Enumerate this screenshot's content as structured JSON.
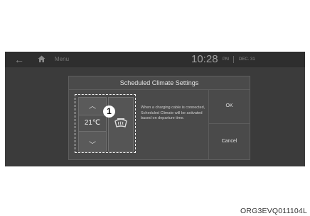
{
  "topbar": {
    "back_icon": "back-arrow-icon",
    "home_icon": "home-icon",
    "menu_label": "Menu",
    "time": "10:28",
    "ampm": "PM",
    "date": "DEC. 31"
  },
  "dialog": {
    "title": "Scheduled Climate Settings",
    "temperature": "21℃",
    "up_icon": "chevron-up-icon",
    "down_icon": "chevron-down-icon",
    "defrost_icon": "front-defrost-icon",
    "marker": "1",
    "description": "When a charging cable is connected, Scheduled Climate will be activated based on departure time.",
    "ok_label": "OK",
    "cancel_label": "Cancel"
  },
  "figure_code": "ORG3EVQ011104L"
}
